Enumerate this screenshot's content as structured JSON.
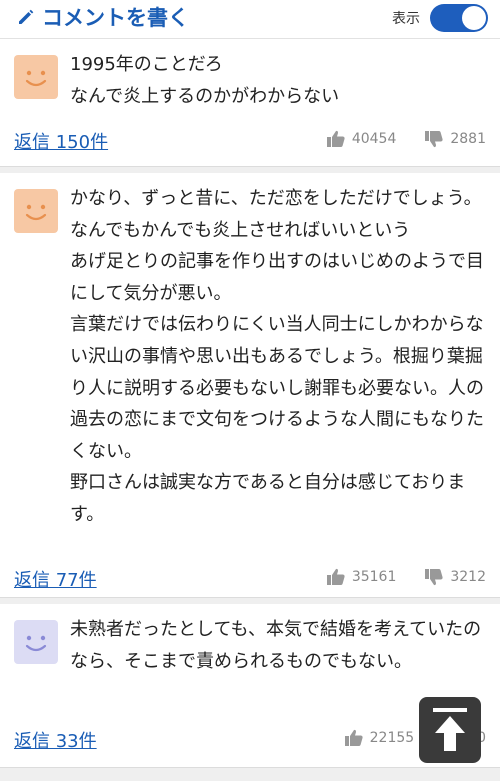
{
  "header": {
    "write_label": "コメントを書く",
    "toggle_label": "表示",
    "toggle_on": true,
    "accent": "#1a5db5"
  },
  "comments": [
    {
      "avatar": "smiley-orange",
      "text": "1995年のことだろ\nなんで炎上するのかがわからない",
      "reply_label": "返信 150件",
      "likes": "40454",
      "dislikes": "2881"
    },
    {
      "avatar": "smiley-orange",
      "text": "かなり、ずっと昔に、ただ恋をしただけでしょう。\nなんでもかんでも炎上させればいいという\nあげ足とりの記事を作り出すのはいじめのようで目にして気分が悪い。\n言葉だけでは伝わりにくい当人同士にしかわからない沢山の事情や思い出もあるでしょう。根掘り葉掘り人に説明する必要もないし謝罪も必要ない。人の過去の恋にまで文句をつけるような人間にもなりたくない。\n野口さんは誠実な方であると自分は感じております。",
      "reply_label": "返信 77件",
      "likes": "35161",
      "dislikes": "3212"
    },
    {
      "avatar": "smiley-lavender",
      "text": "未熟者だったとしても、本気で結婚を考えていたのなら、そこまで責められるものでもない。",
      "reply_label": "返信 33件",
      "likes": "22155",
      "dislikes": "70"
    }
  ],
  "scroll_top": {
    "icon": "arrow-up-icon"
  }
}
